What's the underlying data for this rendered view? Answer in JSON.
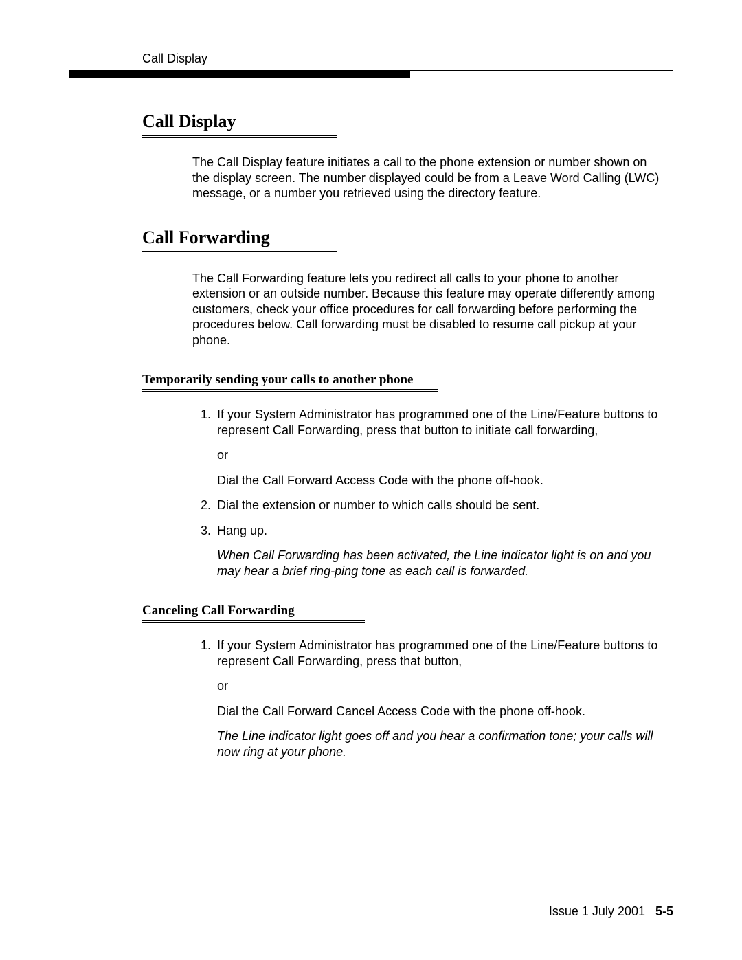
{
  "running_head": "Call Display",
  "section1": {
    "title": "Call Display",
    "body": "The Call Display feature initiates a call to the phone extension or number shown on the display screen. The number displayed could be from a Leave Word Calling (LWC) message, or a number you retrieved using the directory feature."
  },
  "section2": {
    "title": "Call Forwarding",
    "body": "The Call Forwarding feature lets you redirect all calls to your phone to another extension or an outside number. Because this feature may operate differently among customers, check your office procedures for call forwarding before performing the procedures below. Call forwarding must be disabled to resume call pickup at your phone.",
    "sub1": {
      "title": "Temporarily sending your calls to another phone",
      "steps": {
        "s1_a": "If your System Administrator has programmed one of the Line/Feature buttons to represent Call Forwarding, press that button to initiate call forwarding,",
        "s1_or": "or",
        "s1_b": "Dial the Call Forward Access Code with the phone off-hook.",
        "s2": "Dial the extension or number to which calls should be sent.",
        "s3": "Hang up.",
        "s3_note": "When Call Forwarding has been activated, the Line indicator light is on and you may hear a brief ring-ping tone as each call is forwarded."
      }
    },
    "sub2": {
      "title": "Canceling Call Forwarding",
      "steps": {
        "s1_a": "If your System Administrator has programmed one of the Line/Feature buttons to represent Call Forwarding, press that button,",
        "s1_or": "or",
        "s1_b": "Dial the Call Forward Cancel Access Code with the phone off-hook.",
        "s1_note": "The Line indicator light goes off and you hear a confirmation tone; your calls will now ring at your phone."
      }
    }
  },
  "footer": {
    "issue": "Issue 1  July 2001",
    "page": "5-5"
  }
}
